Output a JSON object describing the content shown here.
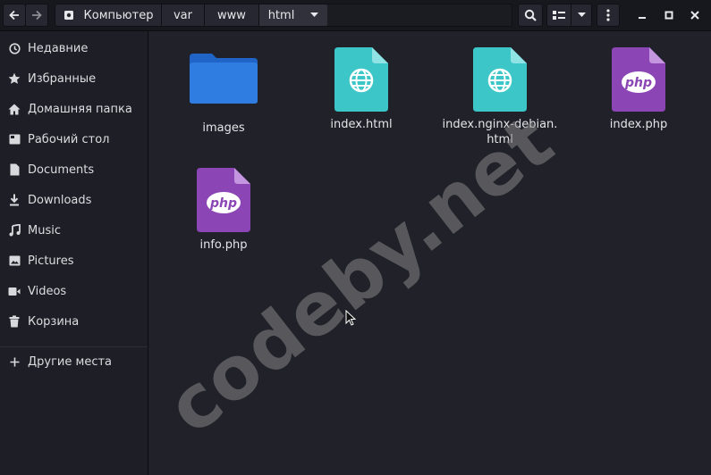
{
  "header": {
    "back_icon": "arrow-left-icon",
    "forward_icon": "arrow-right-icon",
    "path": [
      "Компьютер",
      "var",
      "www",
      "html"
    ],
    "path_root_icon": "drive-icon",
    "path_menu_icon": "chevron-down-icon",
    "search_icon": "search-icon",
    "view_icon": "list-view-icon",
    "view_menu_icon": "chevron-down-icon",
    "menu_icon": "kebab-menu-icon",
    "window_controls": [
      "minimize-icon",
      "maximize-icon",
      "close-icon"
    ]
  },
  "sidebar": {
    "items": [
      {
        "label": "Недавние",
        "icon": "clock-icon"
      },
      {
        "label": "Избранные",
        "icon": "star-icon"
      },
      {
        "label": "Домашняя папка",
        "icon": "home-icon"
      },
      {
        "label": "Рабочий стол",
        "icon": "desktop-icon"
      },
      {
        "label": "Documents",
        "icon": "document-icon"
      },
      {
        "label": "Downloads",
        "icon": "download-icon"
      },
      {
        "label": "Music",
        "icon": "music-icon"
      },
      {
        "label": "Pictures",
        "icon": "pictures-icon"
      },
      {
        "label": "Videos",
        "icon": "video-icon"
      },
      {
        "label": "Корзина",
        "icon": "trash-icon"
      }
    ],
    "other_locations": {
      "label": "Другие места",
      "icon": "plus-icon"
    }
  },
  "files": [
    {
      "name": "images",
      "type": "folder"
    },
    {
      "name": "index.html",
      "type": "html"
    },
    {
      "name": "index.nginx-debian.\nhtml",
      "type": "html"
    },
    {
      "name": "index.php",
      "type": "php"
    },
    {
      "name": "info.php",
      "type": "php"
    }
  ],
  "file_badges": {
    "php": "php"
  },
  "watermark": "codeby.net",
  "colors": {
    "folder": "#2f7de1",
    "html_file": "#3cc6c8",
    "php_file": "#8b45b5",
    "background": "#202129",
    "sidebar": "#1e1f26",
    "headerbar": "#17181d"
  }
}
